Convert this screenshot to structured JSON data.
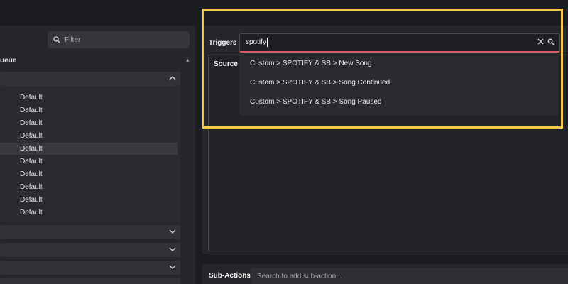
{
  "left": {
    "filter_placeholder": "Filter",
    "queue_header": "ueue",
    "rows": [
      "Default",
      "Default",
      "Default",
      "Default",
      "Default",
      "Default",
      "Default",
      "Default",
      "Default",
      "Default"
    ],
    "selected_row": 4
  },
  "triggers": {
    "label": "Triggers",
    "search_value": "spotify",
    "source_label": "Source",
    "options": [
      "Custom > SPOTIFY & SB > New Song",
      "Custom > SPOTIFY & SB > Song Continued",
      "Custom > SPOTIFY & SB > Song Paused"
    ]
  },
  "sub_actions": {
    "label": "Sub-Actions",
    "placeholder": "Search to add sub-action..."
  },
  "colors": {
    "highlight": "#f3c84c",
    "search_underline": "#e25a66"
  },
  "icons": [
    "search-icon",
    "close-icon",
    "chevron-up-icon",
    "chevron-down-icon",
    "scroll-up-arrow-icon"
  ]
}
